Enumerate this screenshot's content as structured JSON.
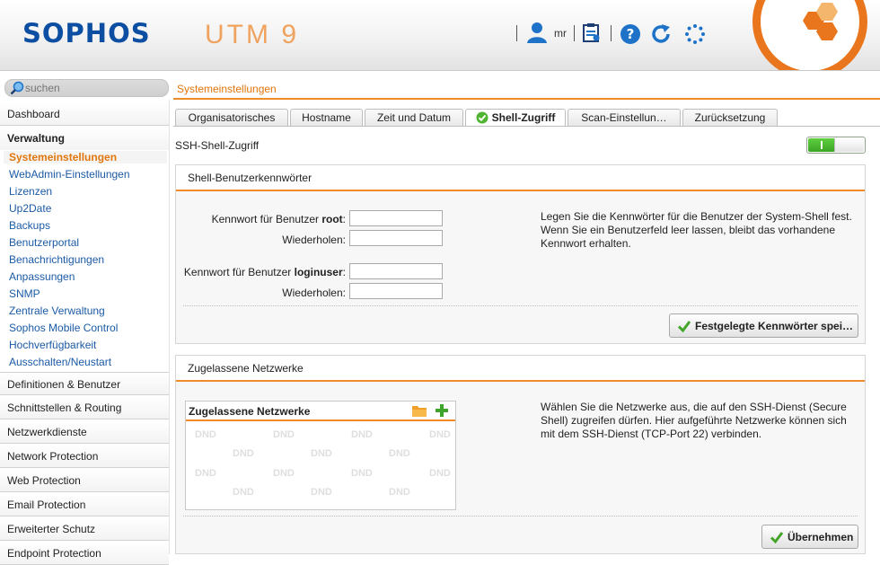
{
  "header": {
    "logo": "SOPHOS",
    "product": "UTM 9",
    "user": "mr"
  },
  "search": {
    "placeholder": "suchen"
  },
  "breadcrumb": "Systemeinstellungen",
  "sidebar": {
    "sections_top": [
      {
        "label": "Dashboard"
      },
      {
        "label": "Verwaltung"
      }
    ],
    "items": [
      {
        "label": "Systemeinstellungen"
      },
      {
        "label": "WebAdmin-Einstellungen"
      },
      {
        "label": "Lizenzen"
      },
      {
        "label": "Up2Date"
      },
      {
        "label": "Backups"
      },
      {
        "label": "Benutzerportal"
      },
      {
        "label": "Benachrichtigungen"
      },
      {
        "label": "Anpassungen"
      },
      {
        "label": "SNMP"
      },
      {
        "label": "Zentrale Verwaltung"
      },
      {
        "label": "Sophos Mobile Control"
      },
      {
        "label": "Hochverfügbarkeit"
      },
      {
        "label": "Ausschalten/Neustart"
      }
    ],
    "sections_bottom": [
      {
        "label": "Definitionen & Benutzer"
      },
      {
        "label": "Schnittstellen & Routing"
      },
      {
        "label": "Netzwerkdienste"
      },
      {
        "label": "Network Protection"
      },
      {
        "label": "Web Protection"
      },
      {
        "label": "Email Protection"
      },
      {
        "label": "Erweiterter Schutz"
      },
      {
        "label": "Endpoint Protection"
      }
    ]
  },
  "tabs": [
    {
      "label": "Organisatorisches"
    },
    {
      "label": "Hostname"
    },
    {
      "label": "Zeit und Datum"
    },
    {
      "label": "Shell-Zugriff"
    },
    {
      "label": "Scan-Einstellun…"
    },
    {
      "label": "Zurücksetzung"
    }
  ],
  "ssh": {
    "label": "SSH-Shell-Zugriff",
    "enabled": true
  },
  "passwords_panel": {
    "title": "Shell-Benutzerkennwörter",
    "root_label_prefix": "Kennwort für Benutzer ",
    "root_user": "root",
    "repeat_label": "Wiederholen:",
    "loginuser_label_prefix": "Kennwort für Benutzer ",
    "loginuser_user": "loginuser",
    "label_colon": ":",
    "root_password": "",
    "root_repeat": "",
    "loginuser_password": "",
    "loginuser_repeat": "",
    "help_text": "Legen Sie die Kennwörter für die Benutzer der System-Shell fest. Wenn Sie ein Benutzerfeld leer lassen, bleibt das vorhandene Kennwort erhalten.",
    "save_button": "Festgelegte Kennwörter spei…"
  },
  "networks_panel": {
    "title": "Zugelassene Netzwerke",
    "list_title": "Zugelassene Netzwerke",
    "dnd_label": "DND",
    "help_text": "Wählen Sie die Netzwerke aus, die auf den SSH-Dienst (Secure Shell) zugreifen dürfen. Hier aufgeführte Netzwerke können sich mit dem SSH-Dienst (TCP-Port 22) verbinden.",
    "apply_button": "Übernehmen"
  },
  "colors": {
    "brand_blue": "#0b4ea2",
    "accent_orange": "#e0760c",
    "link_blue": "#1b5aa5",
    "toggle_green": "#3ca526"
  },
  "icons": [
    "search-icon",
    "user-icon",
    "clipboard-icon",
    "help-icon",
    "refresh-icon",
    "loading-icon",
    "check-icon",
    "folder-icon",
    "plus-icon"
  ]
}
